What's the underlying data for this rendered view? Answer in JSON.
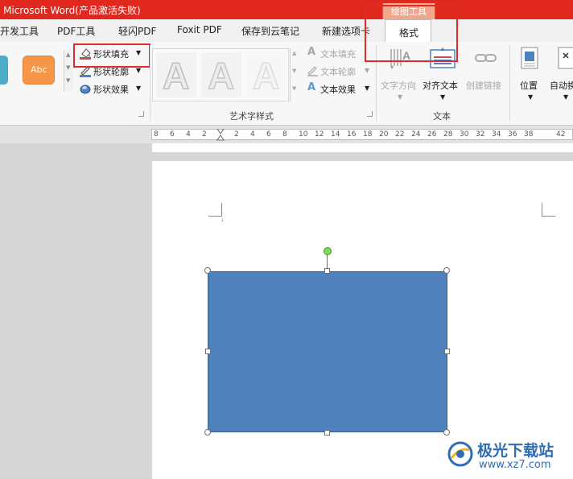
{
  "title_bar": {
    "app_title": "Microsoft Word(产品激活失败)",
    "context_group": "绘图工具"
  },
  "tabs": [
    {
      "label": "开发工具"
    },
    {
      "label": "PDF工具"
    },
    {
      "label": "轻闪PDF"
    },
    {
      "label": "Foxit PDF"
    },
    {
      "label": "保存到云笔记"
    },
    {
      "label": "新建选项卡"
    },
    {
      "label": "格式",
      "active": true
    }
  ],
  "ribbon": {
    "shape_styles": {
      "gallery_item_label": "Abc",
      "fill_label": "形状填充",
      "outline_label": "形状轮廓",
      "effects_label": "形状效果"
    },
    "wordart": {
      "group_label": "艺术字样式",
      "sample_letter": "A",
      "text_fill_label": "文本填充",
      "text_outline_label": "文本轮廓",
      "text_effects_label": "文本效果"
    },
    "text_group": {
      "group_label": "文本",
      "direction_label": "文字方向",
      "align_label": "对齐文本",
      "link_label": "创建链接"
    },
    "arrange": {
      "position_label": "位置",
      "wrap_label": "自动换"
    }
  },
  "ruler": {
    "ticks": [
      "8",
      "6",
      "4",
      "2",
      "",
      "2",
      "4",
      "6",
      "8",
      "10",
      "12",
      "14",
      "16",
      "18",
      "20",
      "22",
      "24",
      "26",
      "28",
      "30",
      "32",
      "34",
      "36",
      "38",
      "",
      "42"
    ]
  },
  "document": {
    "shape_color": "#4f81bd",
    "shape_border_color": "#385d8a"
  },
  "colors": {
    "title_bar": "#e0281e",
    "highlight_red": "#e12a2a",
    "orange_swatch": "#f79646",
    "teal_swatch": "#4bacc6",
    "rotation_handle": "#7ed957"
  },
  "watermark": {
    "brand": "极光下载站",
    "url": "www.xz7.com"
  }
}
